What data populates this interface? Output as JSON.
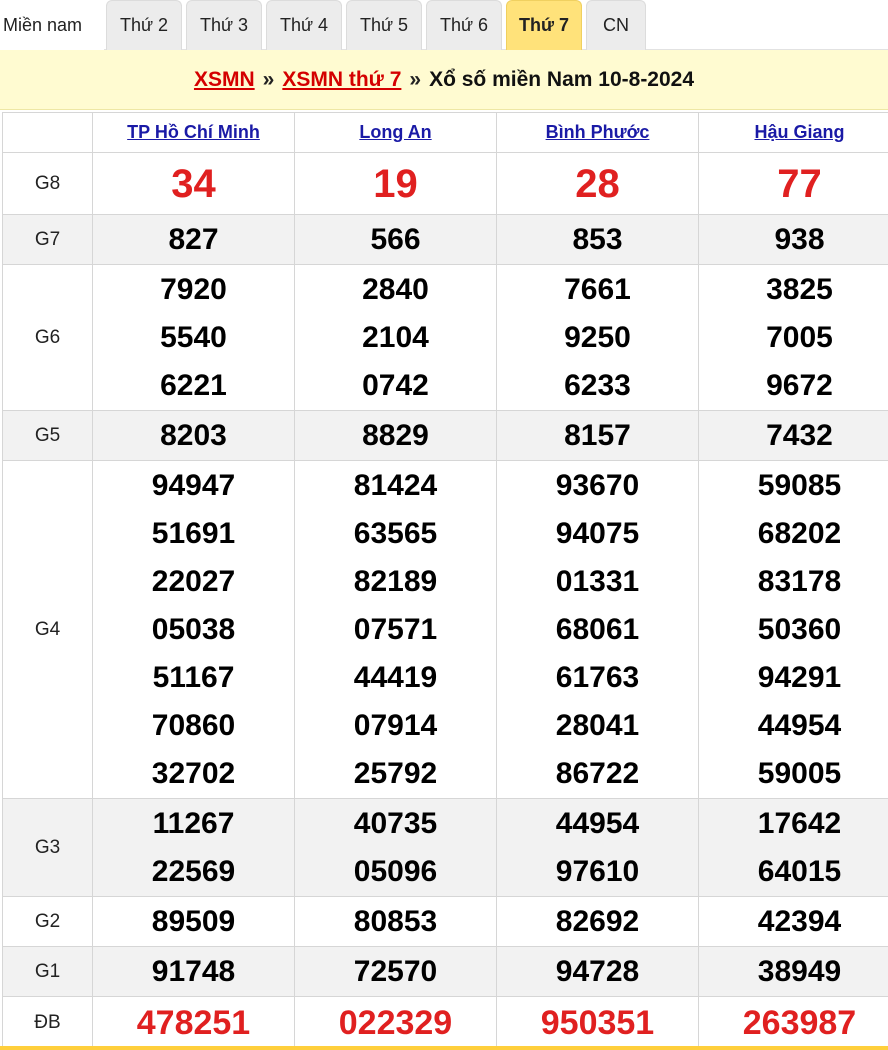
{
  "tabs": [
    {
      "label": "Miền nam",
      "active": false
    },
    {
      "label": "Thứ 2",
      "active": false
    },
    {
      "label": "Thứ 3",
      "active": false
    },
    {
      "label": "Thứ 4",
      "active": false
    },
    {
      "label": "Thứ 5",
      "active": false
    },
    {
      "label": "Thứ 6",
      "active": false
    },
    {
      "label": "Thứ 7",
      "active": true
    },
    {
      "label": "CN",
      "active": false
    }
  ],
  "breadcrumb": {
    "link1": "XSMN",
    "sep": "»",
    "link2": "XSMN thứ 7",
    "title": "Xổ số miền Nam 10-8-2024"
  },
  "provinces": [
    "TP Hồ Chí Minh",
    "Long An",
    "Bình Phước",
    "Hậu Giang"
  ],
  "prizes": [
    {
      "label": "G8",
      "style": "big-red",
      "values": [
        [
          "34"
        ],
        [
          "19"
        ],
        [
          "28"
        ],
        [
          "77"
        ]
      ]
    },
    {
      "label": "G7",
      "style": "num",
      "values": [
        [
          "827"
        ],
        [
          "566"
        ],
        [
          "853"
        ],
        [
          "938"
        ]
      ]
    },
    {
      "label": "G6",
      "style": "num",
      "values": [
        [
          "7920",
          "5540",
          "6221"
        ],
        [
          "2840",
          "2104",
          "0742"
        ],
        [
          "7661",
          "9250",
          "6233"
        ],
        [
          "3825",
          "7005",
          "9672"
        ]
      ]
    },
    {
      "label": "G5",
      "style": "num",
      "values": [
        [
          "8203"
        ],
        [
          "8829"
        ],
        [
          "8157"
        ],
        [
          "7432"
        ]
      ]
    },
    {
      "label": "G4",
      "style": "num",
      "values": [
        [
          "94947",
          "51691",
          "22027",
          "05038",
          "51167",
          "70860",
          "32702"
        ],
        [
          "81424",
          "63565",
          "82189",
          "07571",
          "44419",
          "07914",
          "25792"
        ],
        [
          "93670",
          "94075",
          "01331",
          "68061",
          "61763",
          "28041",
          "86722"
        ],
        [
          "59085",
          "68202",
          "83178",
          "50360",
          "94291",
          "44954",
          "59005"
        ]
      ]
    },
    {
      "label": "G3",
      "style": "num",
      "values": [
        [
          "11267",
          "22569"
        ],
        [
          "40735",
          "05096"
        ],
        [
          "44954",
          "97610"
        ],
        [
          "17642",
          "64015"
        ]
      ]
    },
    {
      "label": "G2",
      "style": "num",
      "values": [
        [
          "89509"
        ],
        [
          "80853"
        ],
        [
          "82692"
        ],
        [
          "42394"
        ]
      ]
    },
    {
      "label": "G1",
      "style": "num",
      "values": [
        [
          "91748"
        ],
        [
          "72570"
        ],
        [
          "94728"
        ],
        [
          "38949"
        ]
      ]
    },
    {
      "label": "ĐB",
      "style": "db-red",
      "values": [
        [
          "478251"
        ],
        [
          "022329"
        ],
        [
          "950351"
        ],
        [
          "263987"
        ]
      ]
    }
  ],
  "colors": {
    "accent_red": "#e02020",
    "link_blue": "#1a1aa6",
    "active_tab": "#ffe27a",
    "crumb_bg": "#fffbd1"
  }
}
